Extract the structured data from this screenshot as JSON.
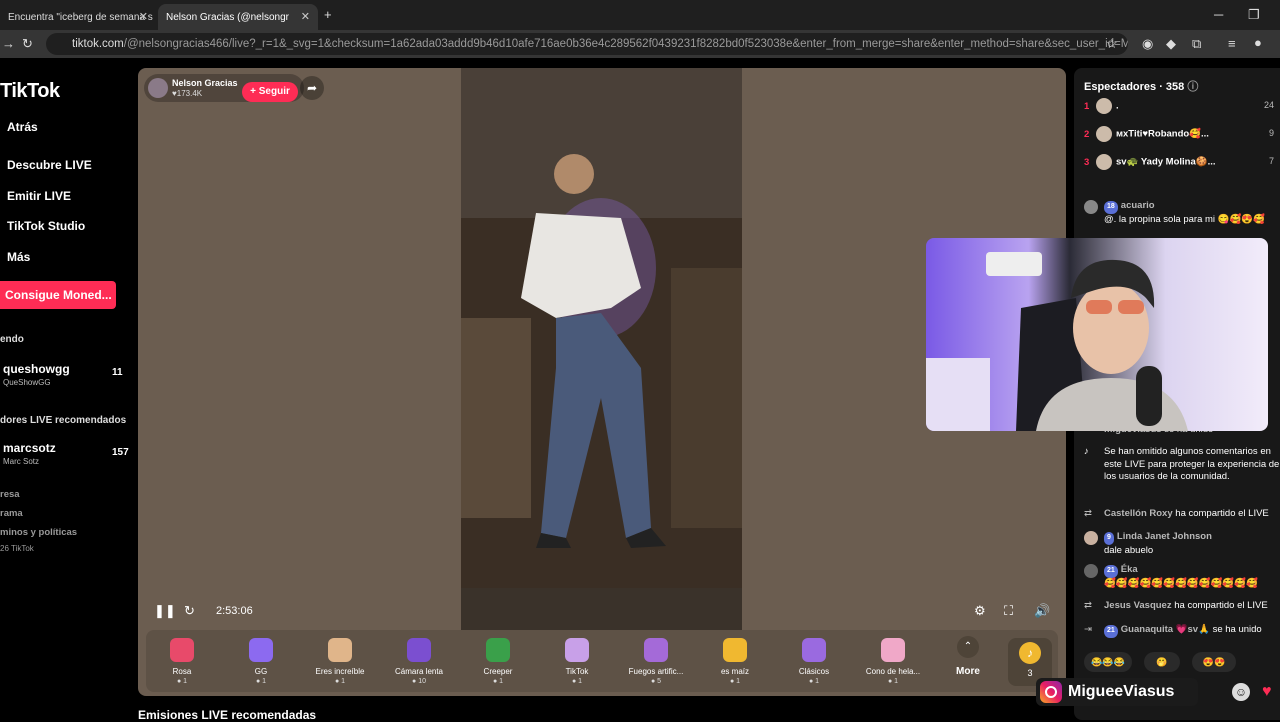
{
  "browser": {
    "tabs": [
      {
        "title": "Encuentra \"iceberg de semana s",
        "active": false
      },
      {
        "title": "Nelson Gracias (@nelsongr",
        "active": true
      }
    ],
    "new_tab": "+",
    "url_host": "tiktok.com",
    "url_path": "/@nelsongracias466/live?_r=1&_svg=1&checksum=1a62ada03addd9b46d10afe716ae0b36e4c289562f0439231f8282bd0f523038e&enter_from_merge=share&enter_method=share&sec_user_id=MS4wLjABAAAAhnQaTxCUNwcc..."
  },
  "sidebar": {
    "logo": "TikTok",
    "nav": [
      "Atrás",
      "Descubre LIVE",
      "Emitir LIVE",
      "TikTok Studio",
      "Más"
    ],
    "cta": "Consigue Moned...",
    "following_heading": "endo",
    "following": [
      {
        "name": "queshowgg",
        "sub": "QueShowGG",
        "count": "11"
      }
    ],
    "recommended_heading": "dores LIVE recomendados",
    "recommended": [
      {
        "name": "marcsotz",
        "sub": "Marc Sotz",
        "count": "157"
      }
    ],
    "footer": [
      "resa",
      "rama",
      "minos y políticas",
      "26 TikTok"
    ]
  },
  "player": {
    "host_name": "Nelson Gracias",
    "host_likes": "♥173.4K",
    "follow": "+ Seguir",
    "time": "2:53:06",
    "gifts": [
      {
        "name": "Rosa",
        "price": "1",
        "color": "#e84a6a"
      },
      {
        "name": "GG",
        "price": "1",
        "color": "#8c6af0"
      },
      {
        "name": "Eres increíble",
        "price": "1",
        "color": "#e0b58a"
      },
      {
        "name": "Cámara lenta",
        "price": "10",
        "color": "#7b4fd0"
      },
      {
        "name": "Creeper",
        "price": "1",
        "color": "#3aa04a"
      },
      {
        "name": "TikTok",
        "price": "1",
        "color": "#c8a0e8"
      },
      {
        "name": "Fuegos artific...",
        "price": "5",
        "color": "#a46ad8"
      },
      {
        "name": "es maíz",
        "price": "1",
        "color": "#f0b830"
      },
      {
        "name": "Clásicos",
        "price": "1",
        "color": "#9a6ae0"
      },
      {
        "name": "Cono de hela...",
        "price": "1",
        "color": "#f0a8c8"
      }
    ],
    "more": "More",
    "coin_count": "3",
    "below_title": "Emisiones LIVE recomendadas"
  },
  "chat": {
    "viewers_heading": "Espectadores · 358",
    "viewers": [
      {
        "rank": "1",
        "name": ".",
        "count": "24"
      },
      {
        "rank": "2",
        "name": "мxTiti♥Robando🥰...",
        "count": "9"
      },
      {
        "rank": "3",
        "name": "sv🐢 Yady Molina🍪...",
        "count": "7"
      }
    ],
    "messages": [
      {
        "badge": "18",
        "user": "acuario",
        "text": "@. la propina sola para mi 😋🥰😍🥰"
      },
      {
        "badge": "",
        "user": "migueviasus",
        "text": "se ha unido"
      },
      {
        "badge": "",
        "user": "",
        "text": "Se han omitido algunos comentarios en este LIVE para proteger la experiencia de los usuarios de la comunidad."
      },
      {
        "badge": "",
        "user": "Castellón Roxy",
        "text": "ha compartido el LIVE"
      },
      {
        "badge": "9",
        "user": "Linda Janet Johnson",
        "text": "dale abuelo"
      },
      {
        "badge": "21",
        "user": "Éka",
        "text": "🥰🥰🥰🥰🥰🥰🥰🥰🥰🥰🥰🥰🥰"
      },
      {
        "badge": "",
        "user": "Jesus Vasquez",
        "text": "ha compartido el LIVE"
      },
      {
        "badge": "21",
        "user": "Guanaquita 💗sv🙏",
        "text": "se ha unido"
      }
    ],
    "reactions": [
      "😂😂😂",
      "🤭",
      "😍😍"
    ]
  },
  "overlay": {
    "instagram": "MigueeViasus"
  }
}
